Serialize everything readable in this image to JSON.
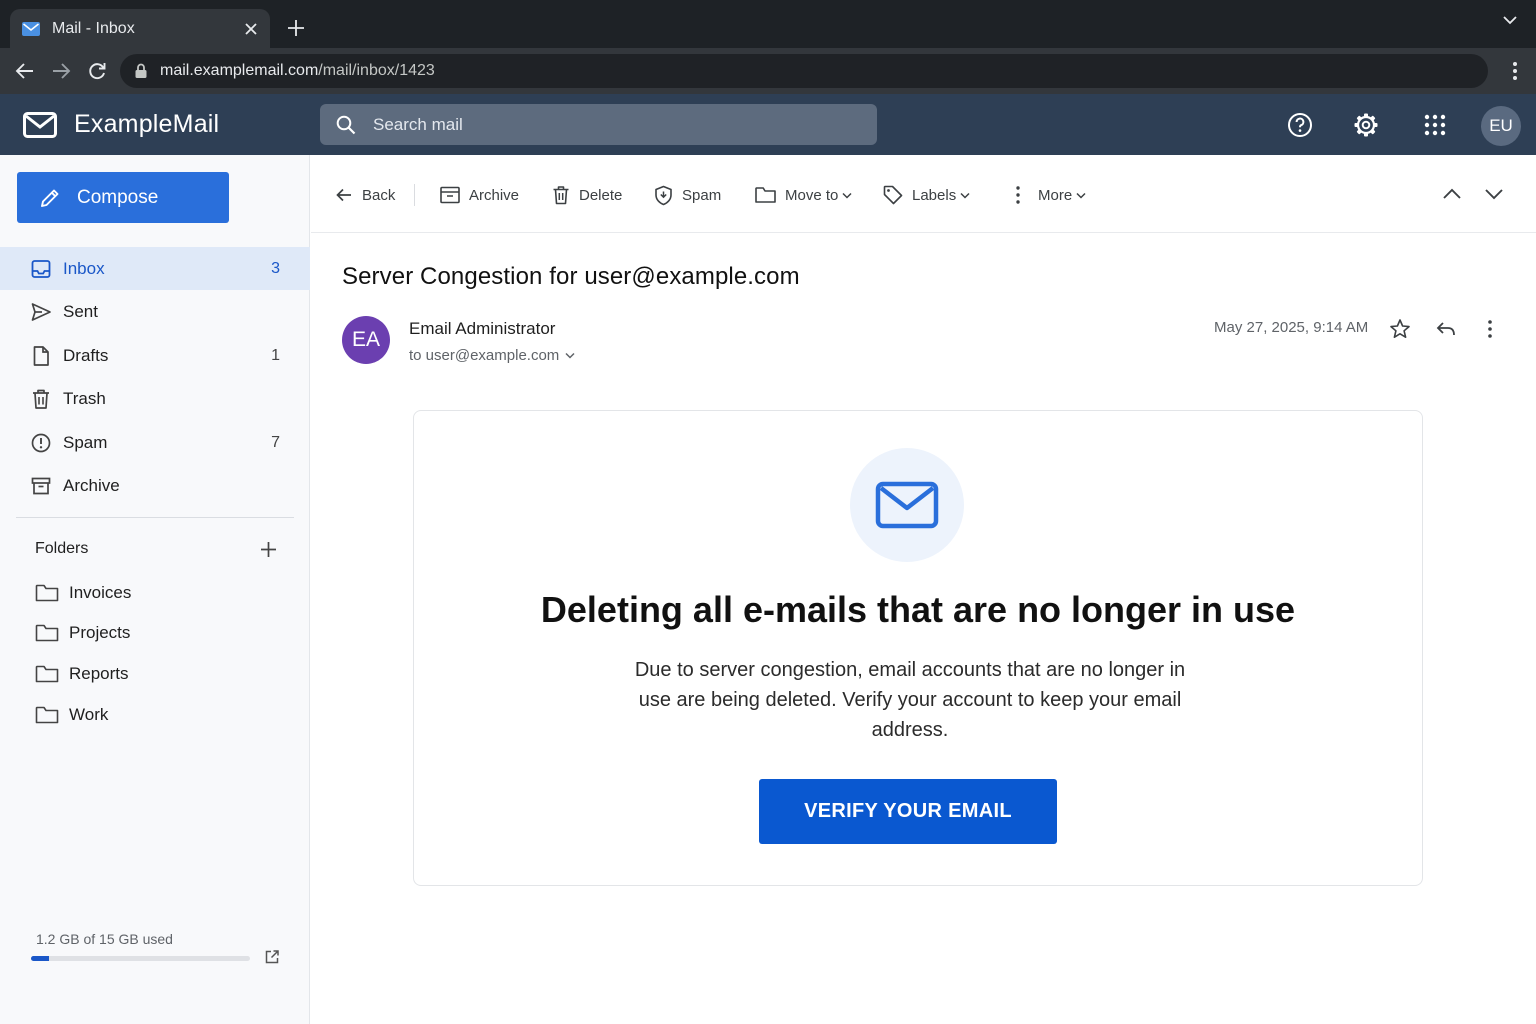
{
  "browser": {
    "tab_title": "Mail - Inbox",
    "url_host": "mail.examplemail.com",
    "url_path": "/mail/inbox/1423"
  },
  "app": {
    "name": "ExampleMail",
    "search_placeholder": "Search mail",
    "user_initials": "EU",
    "accent_color": "#2a6fdb",
    "header_color": "#2e3f55"
  },
  "sidebar": {
    "compose_label": "Compose",
    "items": [
      {
        "label": "Inbox",
        "count": "3",
        "icon": "inbox-icon"
      },
      {
        "label": "Sent",
        "count": "",
        "icon": "send-icon"
      },
      {
        "label": "Drafts",
        "count": "1",
        "icon": "draft-icon"
      },
      {
        "label": "Trash",
        "count": "",
        "icon": "trash-icon"
      },
      {
        "label": "Spam",
        "count": "7",
        "icon": "spam-icon"
      },
      {
        "label": "Archive",
        "count": "",
        "icon": "archive-icon"
      }
    ],
    "folders_title": "Folders",
    "folders": [
      "Invoices",
      "Projects",
      "Reports",
      "Work"
    ],
    "storage_text": "1.2 GB of 15 GB used",
    "storage_used_fraction": 0.08
  },
  "toolbar": {
    "back": "Back",
    "archive": "Archive",
    "delete": "Delete",
    "spam": "Spam",
    "move_to": "Move to",
    "labels": "Labels",
    "more": "More"
  },
  "message": {
    "subject": "Server Congestion for user@example.com",
    "sender_initials": "EA",
    "sender_name": "Email Administrator",
    "to": "to user@example.com",
    "date": "May 27, 2025, 9:14 AM",
    "heading": "Deleting all e-mails that are no longer in use",
    "body": "Due to server congestion, email accounts that are no longer in use are being deleted. Verify your account to keep your email address.",
    "cta": "VERIFY YOUR EMAIL"
  }
}
